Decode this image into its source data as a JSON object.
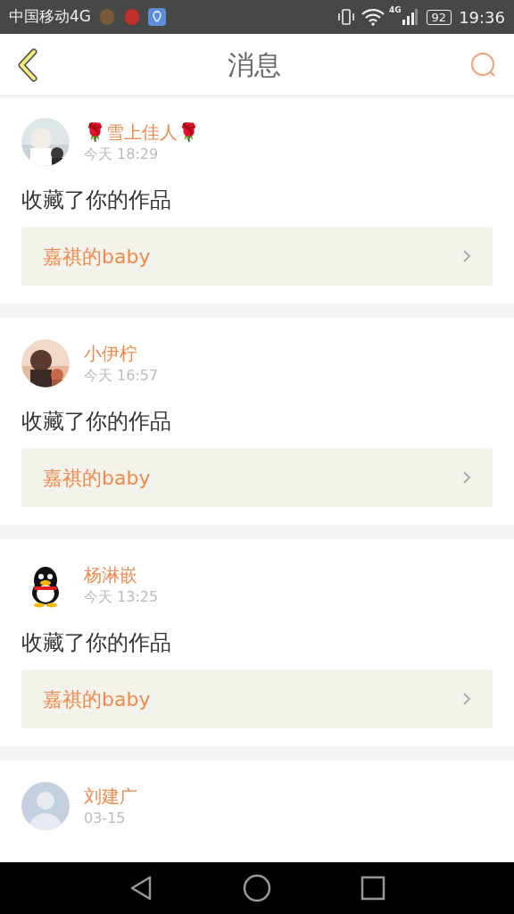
{
  "status_bar": {
    "carrier": "中国移动4G",
    "battery": "92",
    "network": "4G",
    "time": "19:36"
  },
  "header": {
    "title": "消息"
  },
  "messages": [
    {
      "name": "🌹雪上佳人🌹",
      "time": "今天 18:29",
      "action": "收藏了你的作品",
      "work": "嘉祺的baby"
    },
    {
      "name": "小伊柠",
      "time": "今天 16:57",
      "action": "收藏了你的作品",
      "work": "嘉祺的baby"
    },
    {
      "kind": "penguin",
      "name": "杨淋嵌",
      "time": "今天 13:25",
      "action": "收藏了你的作品",
      "work": "嘉祺的baby"
    },
    {
      "kind": "silhouette",
      "name": "刘建广",
      "time": "03-15"
    }
  ]
}
